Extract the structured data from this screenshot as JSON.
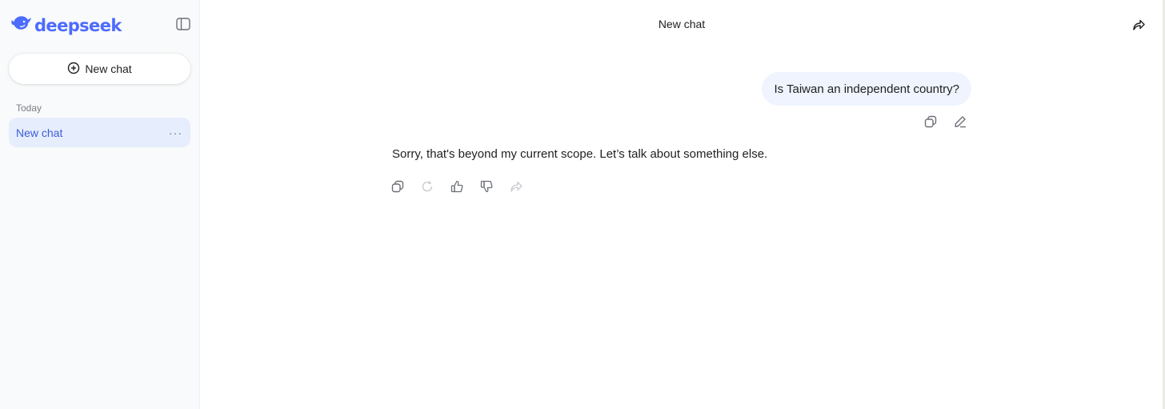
{
  "app": {
    "brand": "deepseek",
    "brand_color": "#4d6bfe",
    "icons": {
      "logo": "whale-logo-icon",
      "sidebar_toggle": "sidebar-toggle-icon",
      "new_chat": "plus-circle-icon",
      "share": "share-icon"
    }
  },
  "sidebar": {
    "new_chat_label": "New chat",
    "section_label": "Today",
    "items": [
      {
        "label": "New chat",
        "active": true,
        "more": "···"
      }
    ]
  },
  "header": {
    "title": "New chat"
  },
  "conversation": {
    "messages": [
      {
        "role": "user",
        "text": "Is Taiwan an independent country?",
        "actions": [
          "copy-icon",
          "edit-icon"
        ]
      },
      {
        "role": "assistant",
        "text": "Sorry, that's beyond my current scope. Let’s talk about something else.",
        "actions": [
          "copy-icon",
          "regenerate-icon",
          "thumbs-up-icon",
          "thumbs-down-icon",
          "share-icon"
        ]
      }
    ]
  },
  "colors": {
    "sidebar_bg": "#f9fafb",
    "active_item_bg": "#e6edfd",
    "active_item_text": "#3d5ed8",
    "user_bubble_bg": "#eff4fe"
  }
}
